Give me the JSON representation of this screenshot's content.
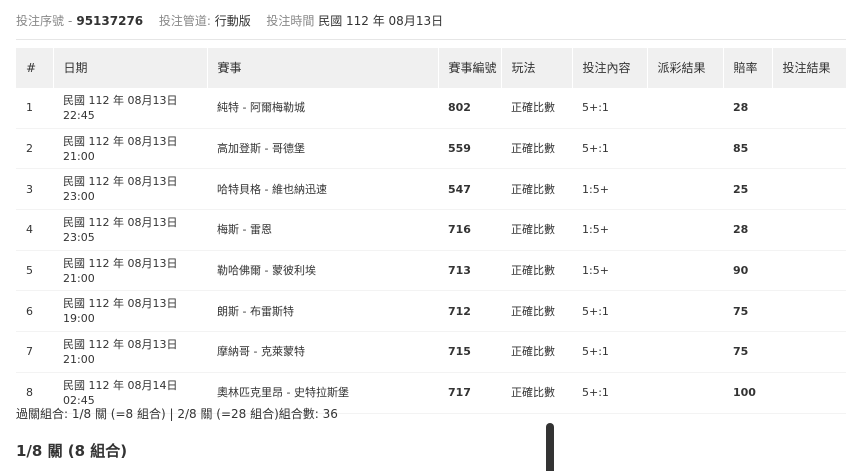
{
  "info": {
    "serial_label": "投注序號",
    "serial_value": "95137276",
    "channel_label": "投注管道:",
    "channel_value": "行動版",
    "time_label": "投注時間",
    "time_value": "民國 112 年 08月13日"
  },
  "table": {
    "headers": [
      "#",
      "日期",
      "賽事",
      "賽事編號",
      "玩法",
      "投注內容",
      "派彩結果",
      "賠率",
      "投注結果"
    ],
    "rows": [
      {
        "idx": "1",
        "date_line1": "民國 112 年 08月13日",
        "date_line2": "22:45",
        "match": "純特 - 阿爾梅勒城",
        "code": "802",
        "play": "正確比數",
        "content": "5+:1",
        "payout": "",
        "odds": "28",
        "result": ""
      },
      {
        "idx": "2",
        "date_line1": "民國 112 年 08月13日",
        "date_line2": "21:00",
        "match": "高加登斯 - 哥德堡",
        "code": "559",
        "play": "正確比數",
        "content": "5+:1",
        "payout": "",
        "odds": "85",
        "result": ""
      },
      {
        "idx": "3",
        "date_line1": "民國 112 年 08月13日",
        "date_line2": "23:00",
        "match": "哈特貝格 - 維也納迅速",
        "code": "547",
        "play": "正確比數",
        "content": "1:5+",
        "payout": "",
        "odds": "25",
        "result": ""
      },
      {
        "idx": "4",
        "date_line1": "民國 112 年 08月13日",
        "date_line2": "23:05",
        "match": "梅斯 - 雷恩",
        "code": "716",
        "play": "正確比數",
        "content": "1:5+",
        "payout": "",
        "odds": "28",
        "result": ""
      },
      {
        "idx": "5",
        "date_line1": "民國 112 年 08月13日",
        "date_line2": "21:00",
        "match": "勒哈佛爾 - 蒙彼利埃",
        "code": "713",
        "play": "正確比數",
        "content": "1:5+",
        "payout": "",
        "odds": "90",
        "result": ""
      },
      {
        "idx": "6",
        "date_line1": "民國 112 年 08月13日",
        "date_line2": "19:00",
        "match": "朗斯 - 布雷斯特",
        "code": "712",
        "play": "正確比數",
        "content": "5+:1",
        "payout": "",
        "odds": "75",
        "result": ""
      },
      {
        "idx": "7",
        "date_line1": "民國 112 年 08月13日",
        "date_line2": "21:00",
        "match": "摩納哥 - 克萊蒙特",
        "code": "715",
        "play": "正確比數",
        "content": "5+:1",
        "payout": "",
        "odds": "75",
        "result": ""
      },
      {
        "idx": "8",
        "date_line1": "民國 112 年 08月14日",
        "date_line2": "02:45",
        "match": "奧林匹克里昂 - 史特拉斯堡",
        "code": "717",
        "play": "正確比數",
        "content": "5+:1",
        "payout": "",
        "odds": "100",
        "result": ""
      }
    ]
  },
  "summary": "過關組合: 1/8 關 (=8 組合) | 2/8 關 (=28 組合)組合數: 36",
  "section_title": "1/8 關 (8 組合)"
}
